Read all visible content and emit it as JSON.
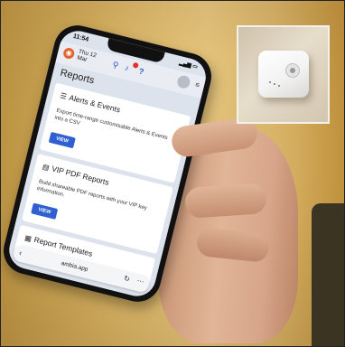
{
  "phone_screen": {
    "status_time": "11:54",
    "header": {
      "date_line1": "Thu 12",
      "date_line2": "Mar"
    },
    "page_title": "Reports",
    "cards": [
      {
        "title": "Alerts & Events",
        "description": "Export time-range customisable Alerts & Events into a CSV",
        "button": "VIEW"
      },
      {
        "title": "VIP PDF Reports",
        "description": "Build shareable PDF reports with your VIP key information.",
        "button": "VIEW"
      },
      {
        "title": "Report Templates"
      }
    ],
    "url": "ambia.app"
  },
  "icons": {
    "logo": "logo-icon",
    "search": "search-icon",
    "notifications": "bell-icon",
    "help": "help-icon",
    "menu": "menu-icon",
    "back": "chevron-left-icon",
    "reload": "reload-icon",
    "more": "more-icon"
  },
  "colors": {
    "accent": "#2f5fd0",
    "logo": "#e4622c",
    "background": "#d9b566"
  }
}
